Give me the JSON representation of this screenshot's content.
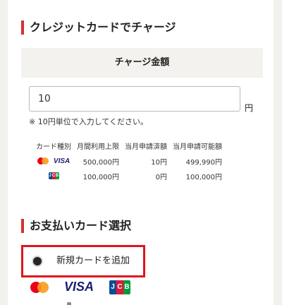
{
  "charge_section": {
    "title": "クレジットカードでチャージ",
    "amount_header": "チャージ金額",
    "amount_value": "10",
    "unit": "円",
    "note": "※ 10円単位で入力してください。"
  },
  "limits_table": {
    "headers": [
      "カード種別",
      "月間利用上限",
      "当月申請済額",
      "当月申請可能額"
    ],
    "rows": [
      {
        "brands": [
          "mastercard-icon",
          "visa-icon"
        ],
        "monthly_limit": "500,000円",
        "applied": "10円",
        "available": "499,990円"
      },
      {
        "brands": [
          "jcb-icon"
        ],
        "monthly_limit": "100,000円",
        "applied": "0円",
        "available": "100,000円"
      }
    ]
  },
  "payment_section": {
    "title": "お支払いカード選択",
    "add_card_label": "新規カードを追加",
    "selected": true,
    "brand_logos": [
      "mastercard-icon",
      "visa-icon",
      "jcb-icon"
    ]
  },
  "brand_text": {
    "visa": "VISA",
    "jcb": [
      "J",
      "C",
      "B"
    ]
  },
  "colors": {
    "accent": "#d5312f",
    "highlight_border": "#e0141e",
    "header_bg": "#f3f2ee",
    "page_bg": "#f2f1ee"
  }
}
